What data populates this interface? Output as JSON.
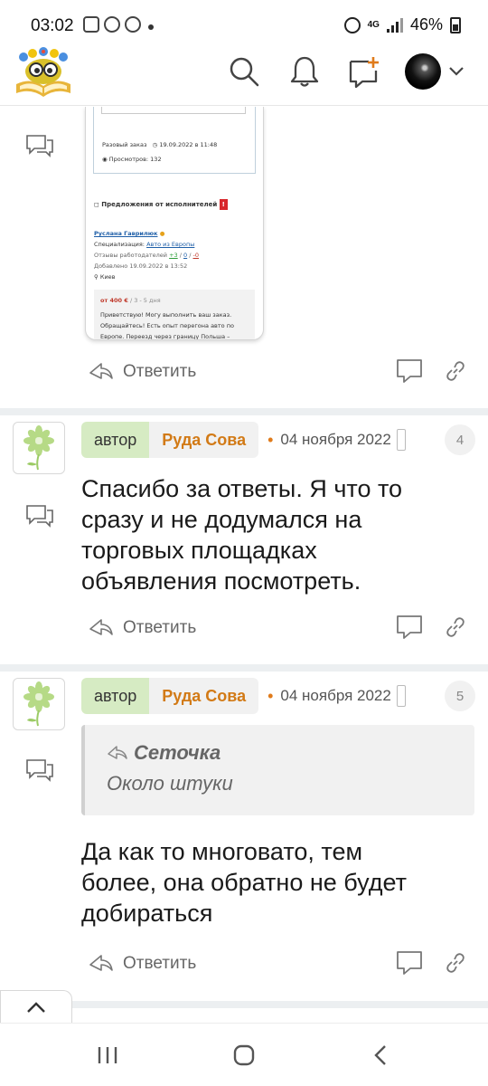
{
  "status_bar": {
    "time": "03:02",
    "network": "4G",
    "battery": "46%"
  },
  "header": {
    "icons": [
      "search-icon",
      "bell-icon",
      "new-post-icon",
      "avatar",
      "chevron-down-icon"
    ]
  },
  "embedded_screenshot": {
    "order_type": "Разовый заказ",
    "order_date": "19.09.2022 в 11:48",
    "views": "Просмотров: 132",
    "offers_title": "Предложения от исполнителей",
    "offers_badge": "!",
    "executor_name": "Руслана Гаврилюк",
    "spec_label": "Специализация:",
    "spec_value": "Авто из Европы",
    "reviews": "Отзывы работодателей",
    "reviews_pos": "+3",
    "reviews_neutral": "0",
    "reviews_neg": "-0",
    "added": "Добавлено 19.09.2022 в 13:52",
    "city": "Киев",
    "price": "от 400 €",
    "price_meta": "/ 3 - 5 дня",
    "offer_line1": "Приветствую! Могу выполнить ваш заказ.",
    "offer_line2": "Обращайтесь! Есть опыт перегона авто по",
    "offer_line3": "Европе. Переезд через границу Польша –"
  },
  "actions": {
    "reply_label": "Ответить"
  },
  "posts": [
    {
      "author_badge": "автор",
      "author_name": "Руда Сова",
      "date": "04 ноября 2022",
      "number": "4",
      "text_lines": [
        "Спасибо за ответы. Я что то",
        "сразу и не додумался на",
        "торговых площадках",
        "объявления посмотреть."
      ]
    },
    {
      "author_badge": "автор",
      "author_name": "Руда Сова",
      "date": "04 ноября 2022",
      "number": "5",
      "quote_author": "Сеточка",
      "quote_text": "Около штуки",
      "text_lines": [
        "Да как то многовато, тем",
        "более, она обратно не будет",
        "добираться"
      ]
    }
  ]
}
